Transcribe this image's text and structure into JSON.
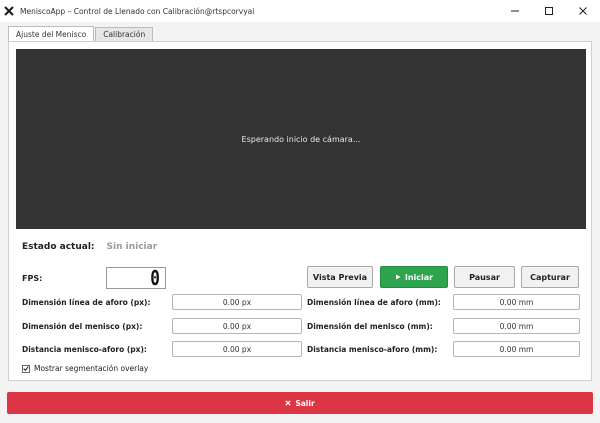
{
  "window": {
    "title": "MeniscoApp – Control de Llenado con Calibración@rtspcorvyai"
  },
  "tabs": [
    {
      "label": "Ajuste del Menisco"
    },
    {
      "label": "Calibración"
    }
  ],
  "camera": {
    "message": "Esperando inicio de cámara..."
  },
  "status": {
    "label": "Estado actual:",
    "value": "Sin iniciar"
  },
  "fps": {
    "label": "FPS:",
    "value": "0"
  },
  "buttons": {
    "preview": "Vista Previa",
    "start": "Iniciar",
    "pause": "Pausar",
    "capture": "Capturar",
    "exit": "Salir"
  },
  "measures": {
    "px": [
      {
        "label": "Dimensión línea de aforo (px):",
        "value": "0.00 px"
      },
      {
        "label": "Dimensión del menisco (px):",
        "value": "0.00 px"
      },
      {
        "label": "Distancia menisco-aforo (px):",
        "value": "0.00 px"
      }
    ],
    "mm": [
      {
        "label": "Dimensión línea de aforo (mm):",
        "value": "0.00 mm"
      },
      {
        "label": "Dimensión del menisco (mm):",
        "value": "0.00 mm"
      },
      {
        "label": "Distancia menisco-aforo (mm):",
        "value": "0.00 mm"
      }
    ]
  },
  "overlay": {
    "label": "Mostrar segmentación overlay",
    "checked": true
  },
  "colors": {
    "start": "#2ea44f",
    "exit": "#dc3545",
    "camera": "#333333"
  }
}
